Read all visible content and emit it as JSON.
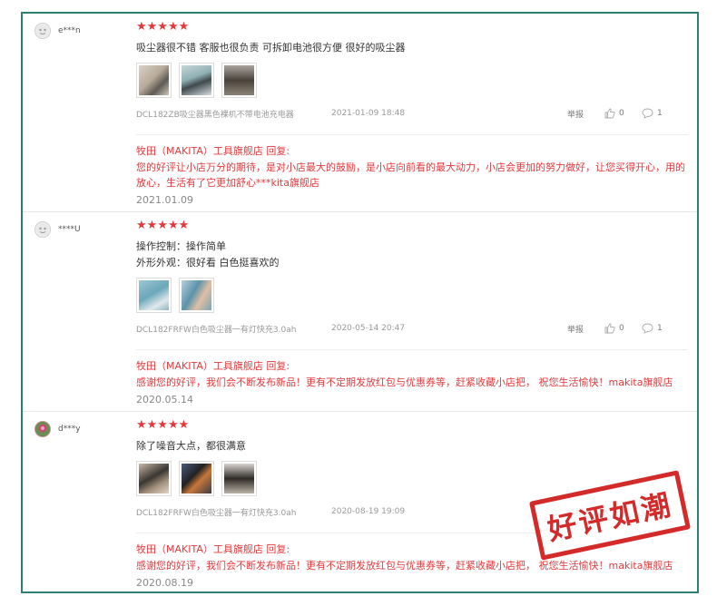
{
  "reviews": [
    {
      "user": "e***n",
      "stars": "★★★★★",
      "text_lines": [
        "吸尘器很不错 客服也很负责 可拆卸电池很方便 很好的吸尘器"
      ],
      "sku": "DCL182ZB吸尘器黑色裸机不带电池充电器",
      "date": "2021-01-09 18:48",
      "report": "举报",
      "likes": "0",
      "comments": "1",
      "reply_head": "牧田（MAKITA）工具旗舰店 回复:",
      "reply_text": "您的好评让小店万分的期待，是对小店最大的鼓励，是小店向前看的最大动力，小店会更加的努力做好，让您买得开心，用的放心，生活有了它更加舒心***kita旗舰店",
      "reply_date": "2021.01.09"
    },
    {
      "user": "****U",
      "stars": "★★★★★",
      "text_lines": [
        "操作控制：操作简单",
        "外形外观：很好看 白色挺喜欢的"
      ],
      "sku": "DCL182FRFW白色吸尘器一有灯快充3.0ah",
      "date": "2020-05-14 20:47",
      "report": "举报",
      "likes": "0",
      "comments": "1",
      "reply_head": "牧田（MAKITA）工具旗舰店 回复:",
      "reply_text": "感谢您的好评，我们会不断发布新品！更有不定期发放红包与优惠券等，赶紧收藏小店把， 祝您生活愉快！makita旗舰店",
      "reply_date": "2020.05.14"
    },
    {
      "user": "d***y",
      "stars": "★★★★★",
      "text_lines": [
        "除了噪音大点，都很满意"
      ],
      "sku": "DCL182FRFW白色吸尘器一有灯快充3.0ah",
      "date": "2020-08-19 19:09",
      "report": "举报",
      "likes": "0",
      "comments": "1",
      "reply_head": "牧田（MAKITA）工具旗舰店 回复:",
      "reply_text": "感谢您的好评，我们会不断发布新品！更有不定期发放红包与优惠券等，赶紧收藏小店把， 祝您生活愉快！makita旗舰店",
      "reply_date": "2020.08.19"
    }
  ],
  "stamp": "好评如潮",
  "colors": {
    "frame": "#2b7f73",
    "accent": "#e4393c"
  }
}
